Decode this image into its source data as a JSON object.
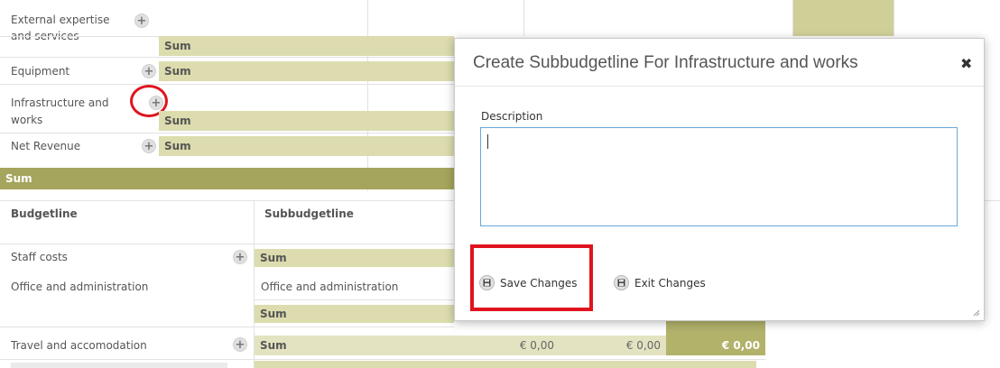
{
  "top_table": {
    "rows": [
      {
        "label_line1": "External expertise",
        "label_line2": "and services",
        "sum": "Sum"
      },
      {
        "label_line1": "Equipment",
        "sum": "Sum"
      },
      {
        "label_line1": "Infrastructure and",
        "label_line2": "works",
        "sum": "Sum"
      },
      {
        "label_line1": "Net Revenue",
        "sum": "Sum"
      }
    ],
    "total_label": "Sum"
  },
  "bottom_table": {
    "headers": {
      "budgetline": "Budgetline",
      "subbudgetline": "Subbudgetline"
    },
    "rows": [
      {
        "budgetline": "Staff costs",
        "sub": "Sum"
      },
      {
        "budgetline": "Office and administration",
        "sub": "Office and administration"
      },
      {
        "budgetline": "",
        "sub": "Sum"
      },
      {
        "budgetline": "Travel and accomodation",
        "sub": "Sum",
        "v1": "€ 0,00",
        "v2": "€ 0,00",
        "v3": "€ 0,00"
      }
    ]
  },
  "modal": {
    "title": "Create Subbudgetline For Infrastructure and works",
    "close": "✖",
    "description_label": "Description",
    "description_value": "",
    "save_label": "Save Changes",
    "exit_label": "Exit Changes"
  },
  "colors": {
    "sum_light": "#dcdcae",
    "sum_dark": "#a5a55d",
    "highlight": "#e0141e",
    "input_border": "#67a9dc"
  }
}
